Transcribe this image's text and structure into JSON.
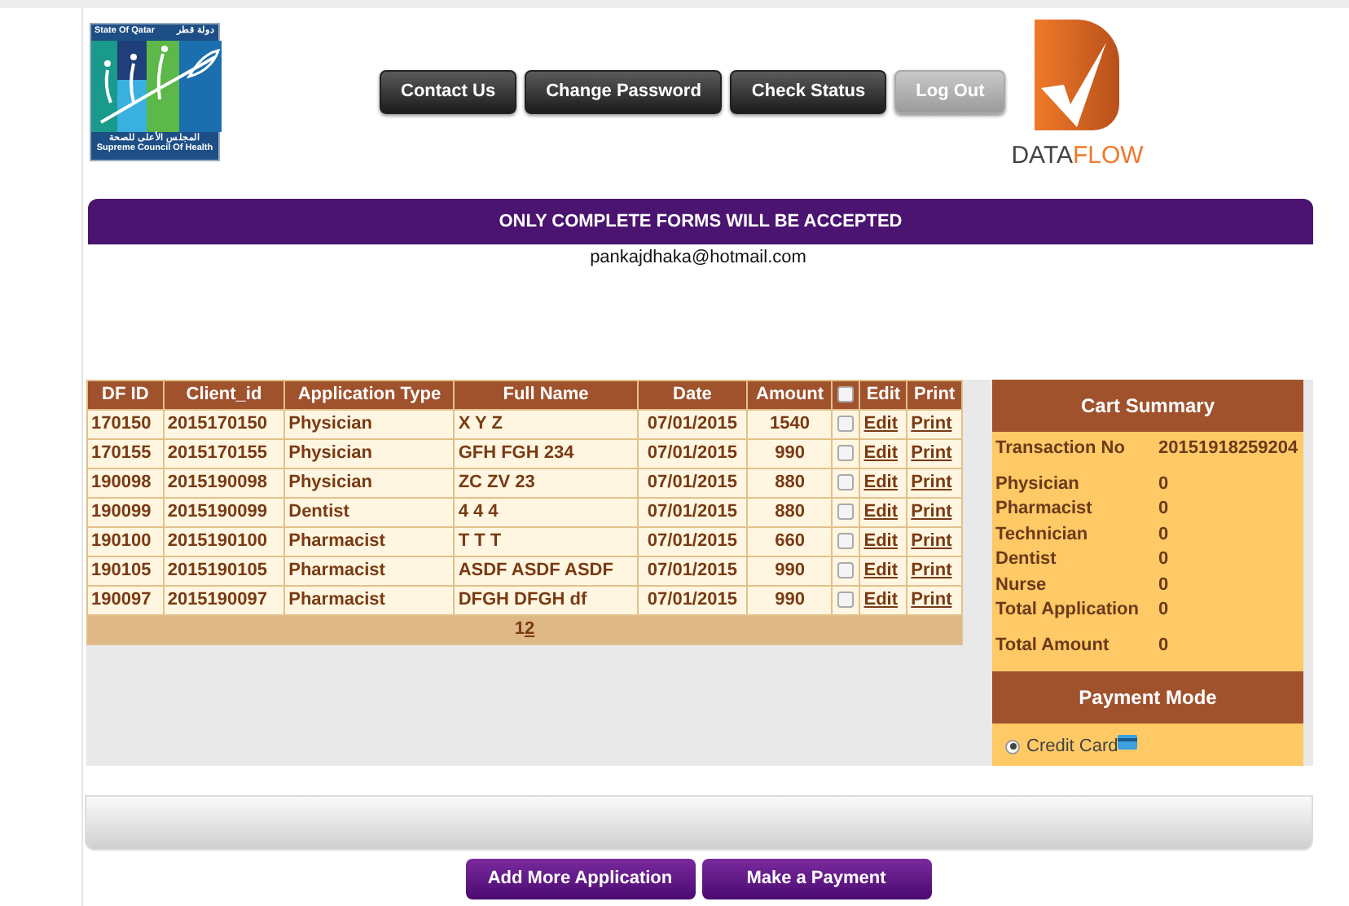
{
  "logo": {
    "top_latin": "State Of Qatar",
    "top_arabic": "دولة قطر",
    "bottom_arabic": "المجلس الأعلى للصحة",
    "bottom_latin": "Supreme Council Of Health"
  },
  "nav_buttons": [
    {
      "label": "Contact Us",
      "highlighted": false
    },
    {
      "label": "Change Password",
      "highlighted": false
    },
    {
      "label": "Check Status",
      "highlighted": false
    },
    {
      "label": "Log Out",
      "highlighted": true
    }
  ],
  "brand": {
    "first": "DATA",
    "second": "FLOW"
  },
  "banner": "ONLY COMPLETE FORMS WILL BE ACCEPTED",
  "email": "pankajdhaka@hotmail.com",
  "table": {
    "columns": [
      "DF ID",
      "Client_id",
      "Application Type",
      "Full Name",
      "Date",
      "Amount"
    ],
    "select_all_checked": false,
    "edit_column": "Edit",
    "print_column": "Print",
    "rows": [
      {
        "df_id": "170150",
        "client_id": "2015170150",
        "type": "Physician",
        "name": "X Y Z",
        "date": "07/01/2015",
        "amount": "1540",
        "checked": false,
        "edit": "Edit",
        "print": "Print"
      },
      {
        "df_id": "170155",
        "client_id": "2015170155",
        "type": "Physician",
        "name": "GFH FGH 234",
        "date": "07/01/2015",
        "amount": "990",
        "checked": false,
        "edit": "Edit",
        "print": "Print"
      },
      {
        "df_id": "190098",
        "client_id": "2015190098",
        "type": "Physician",
        "name": "ZC ZV 23",
        "date": "07/01/2015",
        "amount": "880",
        "checked": false,
        "edit": "Edit",
        "print": "Print"
      },
      {
        "df_id": "190099",
        "client_id": "2015190099",
        "type": "Dentist",
        "name": "4 4 4",
        "date": "07/01/2015",
        "amount": "880",
        "checked": false,
        "edit": "Edit",
        "print": "Print"
      },
      {
        "df_id": "190100",
        "client_id": "2015190100",
        "type": "Pharmacist",
        "name": "T T T",
        "date": "07/01/2015",
        "amount": "660",
        "checked": false,
        "edit": "Edit",
        "print": "Print"
      },
      {
        "df_id": "190105",
        "client_id": "2015190105",
        "type": "Pharmacist",
        "name": "ASDF ASDF ASDF",
        "date": "07/01/2015",
        "amount": "990",
        "checked": false,
        "edit": "Edit",
        "print": "Print"
      },
      {
        "df_id": "190097",
        "client_id": "2015190097",
        "type": "Pharmacist",
        "name": "DFGH DFGH df",
        "date": "07/01/2015",
        "amount": "990",
        "checked": false,
        "edit": "Edit",
        "print": "Print"
      }
    ],
    "pages": [
      {
        "label": "1",
        "selected": true
      },
      {
        "label": "2",
        "selected": false
      }
    ]
  },
  "cart": {
    "title": "Cart Summary",
    "rows": [
      {
        "label": "Transaction No",
        "value": "20151918259204"
      },
      {
        "label": "Physician",
        "value": "0"
      },
      {
        "label": "Pharmacist",
        "value": "0"
      },
      {
        "label": "Technician",
        "value": "0"
      },
      {
        "label": "Dentist",
        "value": "0"
      },
      {
        "label": "Nurse",
        "value": "0"
      },
      {
        "label": "Total Application",
        "value": "0"
      },
      {
        "label": "Total Amount",
        "value": "0"
      }
    ],
    "payment_title": "Payment Mode",
    "payment_options": [
      {
        "label": "Credit Card",
        "selected": true
      }
    ]
  },
  "actions": [
    "Add More Application",
    "Make a Payment"
  ]
}
